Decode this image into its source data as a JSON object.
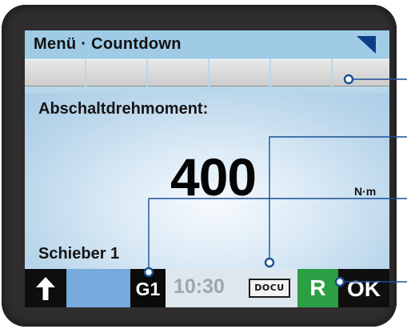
{
  "header": {
    "title": "Menü · Countdown",
    "corner_icon": "blue-triangle-flag"
  },
  "softkeys": {
    "count": 6
  },
  "main": {
    "label": "Abschaltdrehmoment:",
    "value": "400",
    "unit": "N·m",
    "valve_label": "Schieber 1"
  },
  "status_bar": {
    "up_icon": "arrow-up-icon",
    "group": "G1",
    "time": "10:30",
    "docu": "DOCU",
    "remote": "R",
    "ok": "OK"
  },
  "colors": {
    "title_bar": "#9fcbe6",
    "flag": "#0c3e86",
    "remote_green": "#2c9f44",
    "callout": "#1b4f95",
    "bezel": "#2f2d2d"
  }
}
